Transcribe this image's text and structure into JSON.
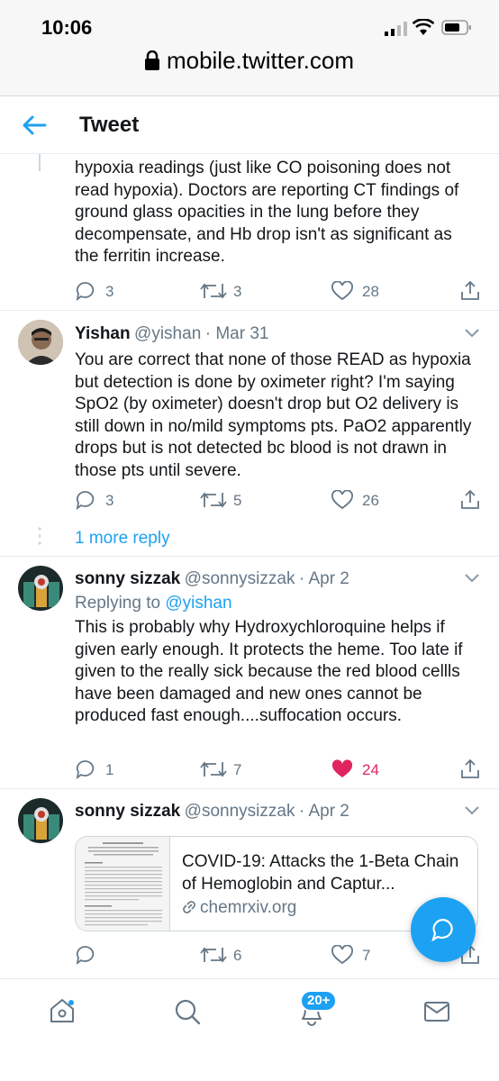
{
  "status_bar": {
    "time": "10:06"
  },
  "browser": {
    "url": "mobile.twitter.com"
  },
  "header": {
    "title": "Tweet"
  },
  "tweet0": {
    "text": "hypoxia readings (just like CO poisoning does not read hypoxia). Doctors are reporting CT findings of ground glass opacities in the lung before they decompensate, and Hb drop isn't as significant as the ferritin increase.",
    "replies": "3",
    "retweets": "3",
    "likes": "28"
  },
  "tweet1": {
    "name": "Yishan",
    "handle": "@yishan",
    "date": "· Mar 31",
    "text": "You are correct that none of those READ as hypoxia but detection is done by oximeter right? I'm saying SpO2 (by oximeter) doesn't drop but O2 delivery is still down in no/mild symptoms pts. PaO2 apparently drops but is not detected bc blood is not drawn in those pts until severe.",
    "replies": "3",
    "retweets": "5",
    "likes": "26"
  },
  "more_replies": "1 more reply",
  "tweet2": {
    "name": "sonny sizzak",
    "handle": "@sonnysizzak",
    "date": "· Apr 2",
    "replying_prefix": "Replying to",
    "replying_to": "@yishan",
    "text": "This is probably why Hydroxychloroquine helps if given early enough.  It protects the heme.  Too late if given to the really sick because the red blood cellls have been damaged and new ones cannot be produced fast enough....suffocation occurs.",
    "replies": "1",
    "retweets": "7",
    "likes": "24"
  },
  "tweet3": {
    "name": "sonny sizzak",
    "handle": "@sonnysizzak",
    "date": "· Apr 2",
    "card_title": "COVID-19: Attacks the 1-Beta Chain of Hemoglobin and Captur...",
    "card_domain": "chemrxiv.org",
    "replies": "",
    "retweets": "6",
    "likes": "7"
  },
  "tabbar": {
    "notifications_badge": "20+"
  },
  "colors": {
    "accent": "#1da1f2",
    "like": "#e0245e",
    "muted": "#657786"
  }
}
